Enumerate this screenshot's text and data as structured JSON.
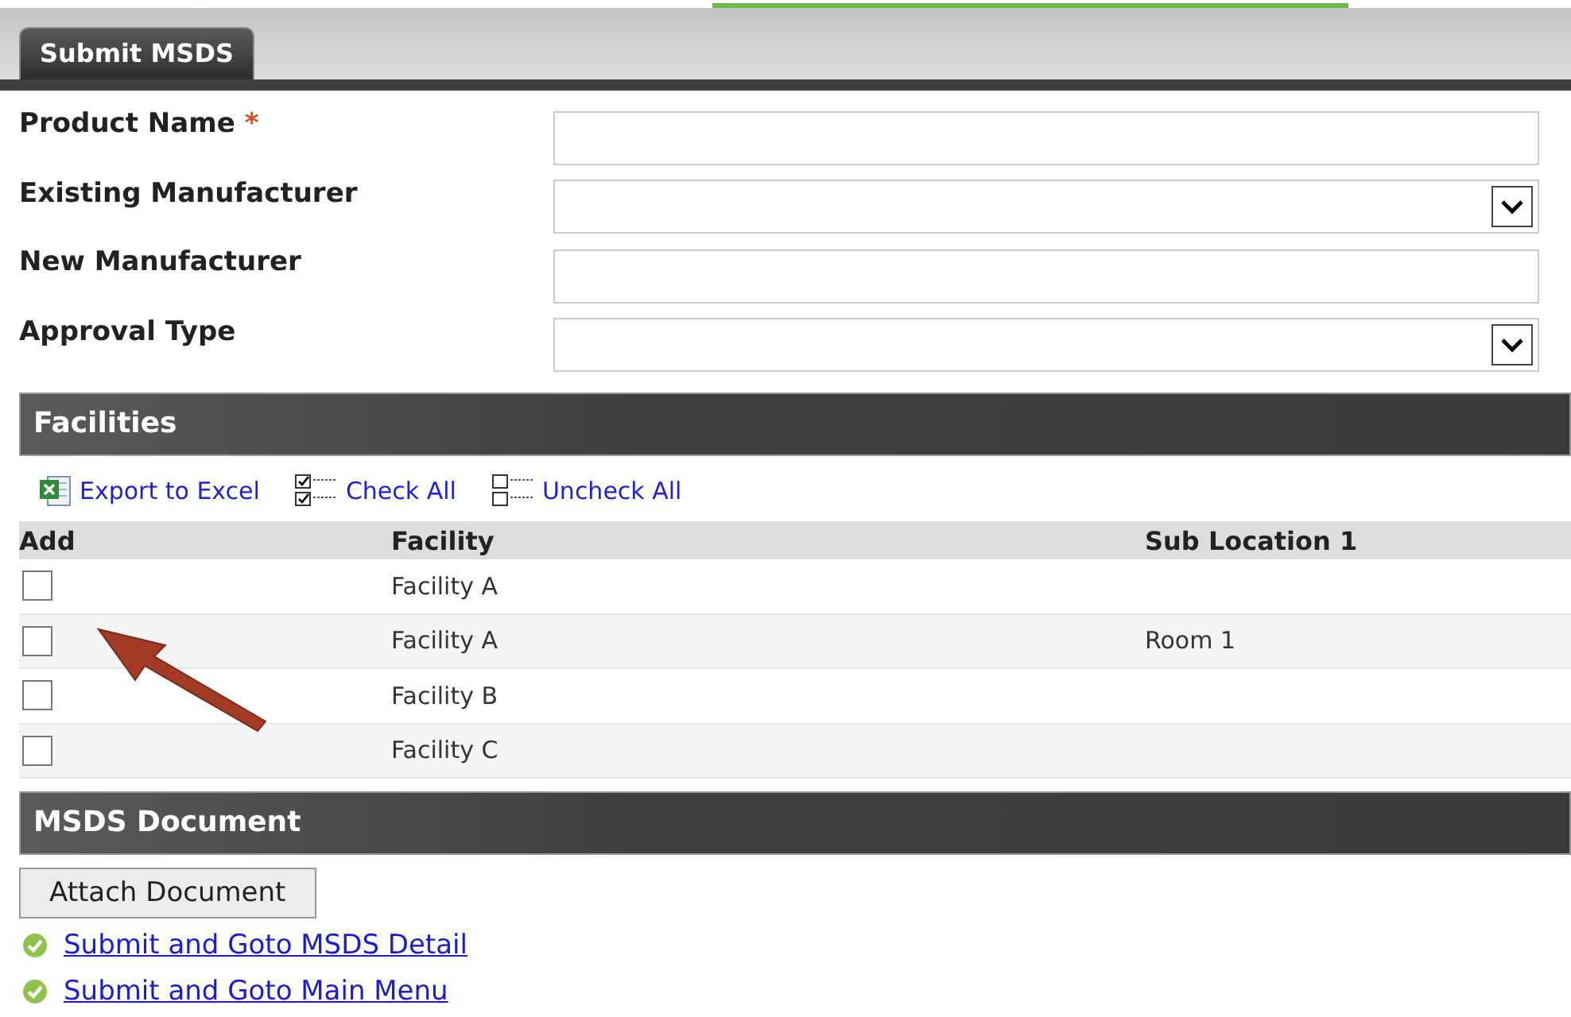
{
  "tabs": [
    {
      "label": "Submit MSDS",
      "selected": true
    }
  ],
  "form": [
    {
      "label": "Product Name",
      "required_mark": "*",
      "kind": "text"
    },
    {
      "label": "Existing Manufacturer",
      "kind": "select"
    },
    {
      "label": "New Manufacturer",
      "kind": "text"
    },
    {
      "label": "Approval Type",
      "kind": "select"
    }
  ],
  "facilities": {
    "title": "Facilities",
    "toolbar": [
      {
        "label": "Export to Excel",
        "kind": "excel"
      },
      {
        "label": "Check All",
        "kind": "check"
      },
      {
        "label": "Uncheck All",
        "kind": "uncheck"
      }
    ],
    "columns": [
      "Add",
      "Facility",
      "Sub Location 1"
    ],
    "rows": [
      {
        "checked": false,
        "facility": "Facility A"
      },
      {
        "checked": false,
        "facility": "Facility A",
        "sub_location": "Room 1"
      },
      {
        "checked": false,
        "facility": "Facility B"
      },
      {
        "checked": false,
        "facility": "Facility C"
      }
    ]
  },
  "document": {
    "title": "MSDS Document",
    "button": "Attach Document",
    "links": [
      "Submit and Goto MSDS Detail",
      "Submit and Goto Main Menu"
    ]
  }
}
